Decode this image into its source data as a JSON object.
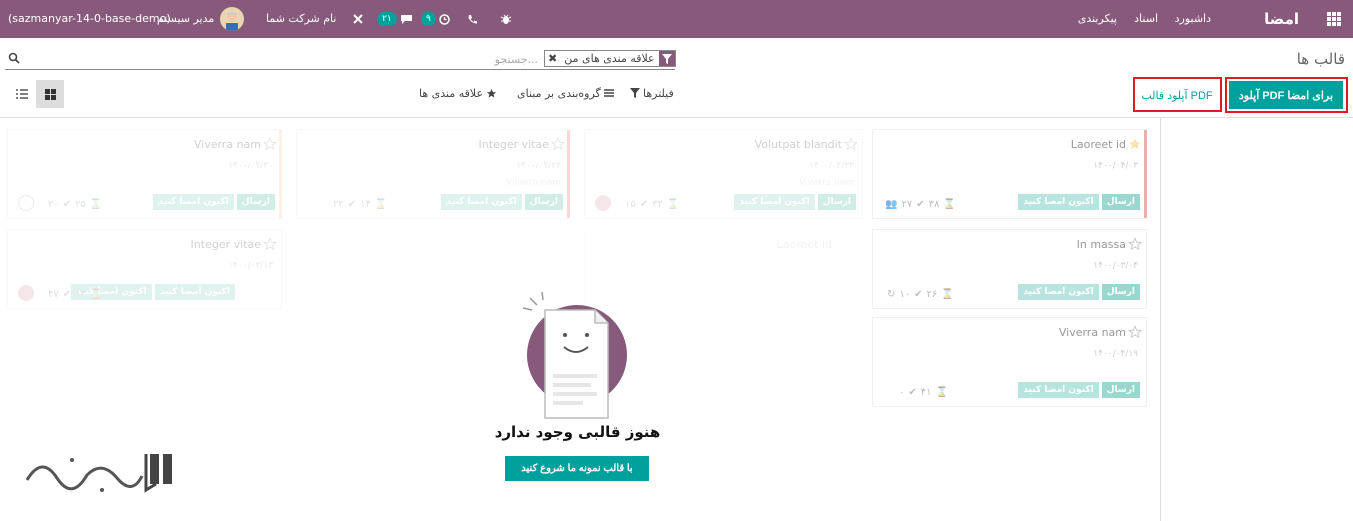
{
  "navbar": {
    "brand": "امضا",
    "menu": [
      "داشبورد",
      "اسناد",
      "پیکربندی"
    ],
    "db_name": "(sazmanyar-14-0-base-demo)",
    "user_name": "مدیر سیستم",
    "company": "نام شرکت شما",
    "messages_count": "۲۱",
    "activities_count": "۹"
  },
  "control_panel": {
    "breadcrumb": "قالب ها",
    "search_placeholder": "جستجو...",
    "facet_label": "علاقه مندی های من",
    "upload_sign_button": "آپلود PDF برای امضا",
    "upload_template_button": "آپلود قالب PDF",
    "filters_label": "فیلترها",
    "groupby_label": "گروه‌بندی بر مبنای",
    "favorites_label": "علاقه مندی ها"
  },
  "colors": {
    "brand": "#875a7b",
    "accent": "#00a09d",
    "highlight": "#e01b24"
  },
  "tags": {
    "send": "ارسال",
    "sign_now": "اکنون امضا کنید"
  },
  "cards": [
    {
      "name": "Laoreet id",
      "date": "۱۴۰۰/۰۴/۰۳",
      "starred": true,
      "s1": "۳۸",
      "s2": "۲۷"
    },
    {
      "name": "Volutpat blandit",
      "date": "۱۴۰۰/۰۴/۲۳",
      "sub": "Viverra nam",
      "s1": "۳۲",
      "s2": "۱۵"
    },
    {
      "name": "Integer vitae",
      "date": "۱۴۰۰/۰۴/۲۳",
      "sub": "Viverra nam",
      "s1": "۱۴",
      "s2": "۲۲"
    },
    {
      "name": "Viverra nam",
      "date": "۱۴۰۰/۰۴/۳۰",
      "s1": "۲۵",
      "s2": "۲۰"
    },
    {
      "name": "In massa",
      "date": "۱۴۰۰/۰۳/۰۴",
      "s1": "۲۶",
      "s2": "۱۰"
    },
    {
      "name": "Integer vitae",
      "date": "۱۴۰۰/۰۳/۱۳",
      "s1": "۱۳",
      "s2": "۴۷"
    },
    {
      "name": "Viverra nam",
      "date": "۱۴۰۰/۰۴/۱۹",
      "s1": "۴۱",
      "s2": "۰"
    },
    {
      "name": "Laoreet id",
      "date": ""
    }
  ],
  "empty_state": {
    "title": "هنوز قالبی وجود ندارد",
    "button": "با قالب نمونه ما شروع کنید"
  }
}
